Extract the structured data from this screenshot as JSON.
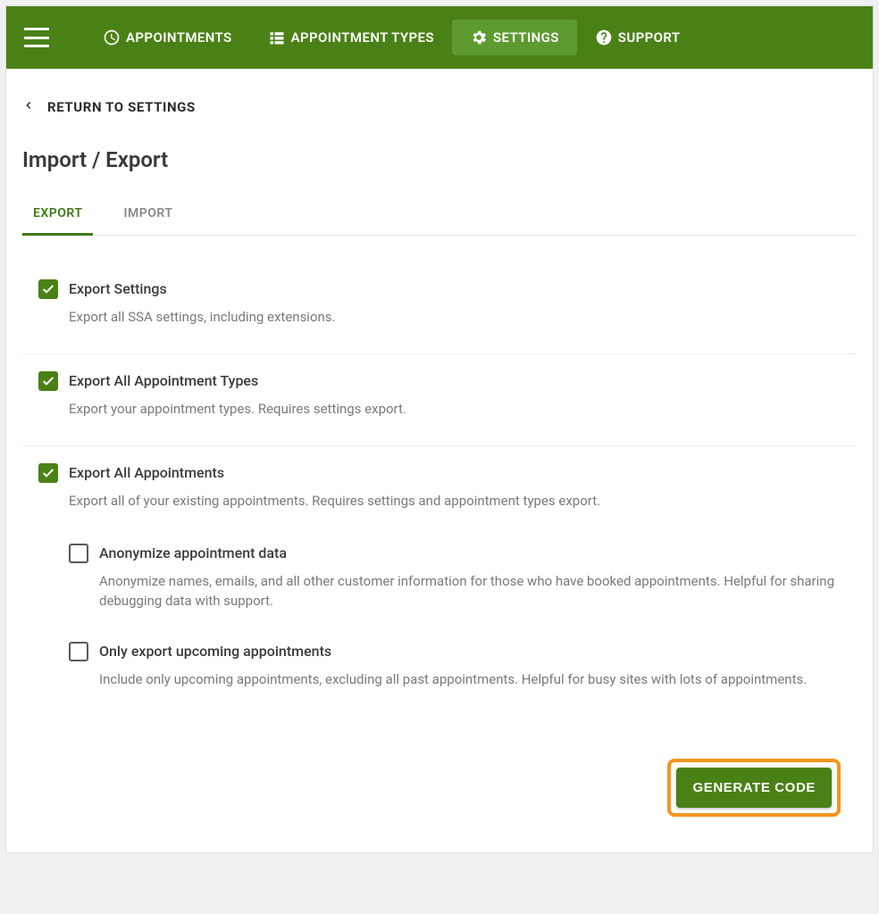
{
  "nav": {
    "items": [
      {
        "label": "APPOINTMENTS",
        "icon": "clock"
      },
      {
        "label": "APPOINTMENT TYPES",
        "icon": "list"
      },
      {
        "label": "SETTINGS",
        "icon": "gear"
      },
      {
        "label": "SUPPORT",
        "icon": "help"
      }
    ],
    "active_index": 2
  },
  "return_label": "RETURN TO SETTINGS",
  "page_title": "Import / Export",
  "tabs": {
    "items": [
      "EXPORT",
      "IMPORT"
    ],
    "active_index": 0
  },
  "options": [
    {
      "checked": true,
      "title": "Export Settings",
      "desc": "Export all SSA settings, including extensions."
    },
    {
      "checked": true,
      "title": "Export All Appointment Types",
      "desc": "Export your appointment types. Requires settings export."
    },
    {
      "checked": true,
      "title": "Export All Appointments",
      "desc": "Export all of your existing appointments. Requires settings and appointment types export.",
      "sub": [
        {
          "checked": false,
          "title": "Anonymize appointment data",
          "desc": "Anonymize names, emails, and all other customer information for those who have booked appointments. Helpful for sharing debugging data with support."
        },
        {
          "checked": false,
          "title": "Only export upcoming appointments",
          "desc": "Include only upcoming appointments, excluding all past appointments. Helpful for busy sites with lots of appointments."
        }
      ]
    }
  ],
  "generate_button": "GENERATE CODE"
}
